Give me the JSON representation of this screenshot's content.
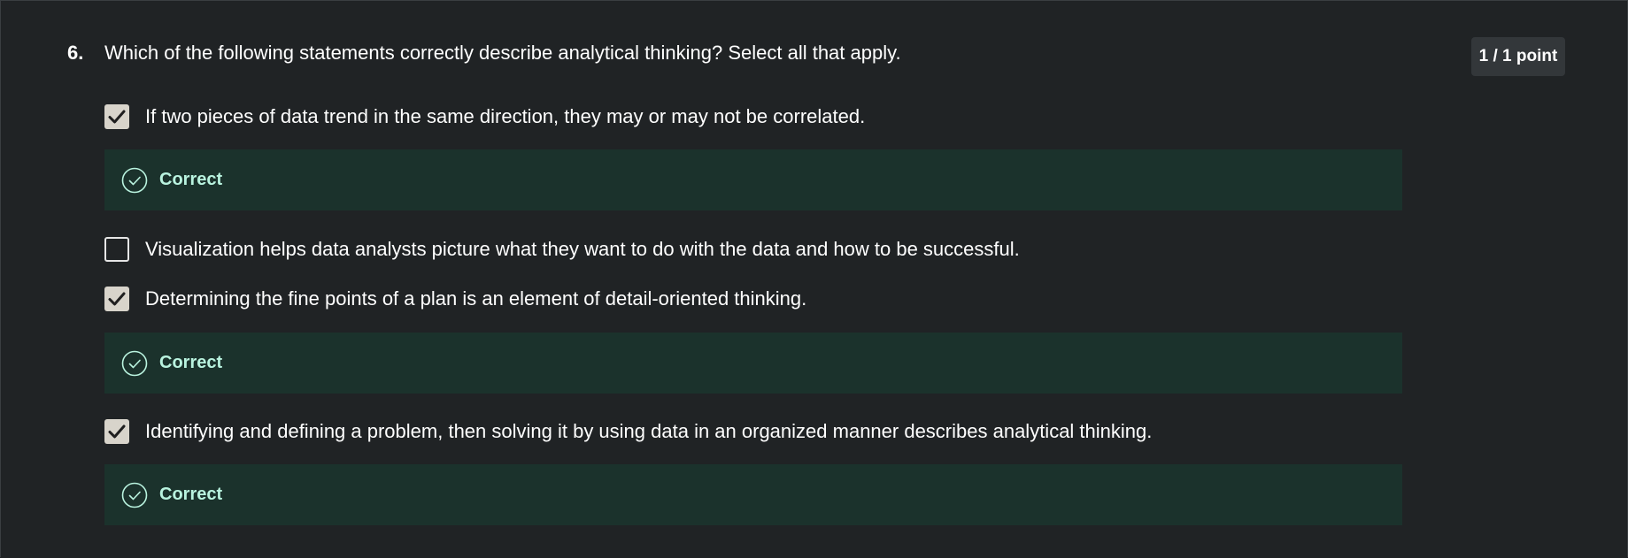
{
  "question": {
    "number": "6.",
    "text": "Which of the following statements correctly describe analytical thinking? Select all that apply.",
    "score": "1 / 1 point"
  },
  "options": [
    {
      "label": "If two pieces of data trend in the same direction, they may or may not be correlated.",
      "checked": true,
      "feedback": "Correct"
    },
    {
      "label": "Visualization helps data analysts picture what they want to do with the data and how to be successful.",
      "checked": false
    },
    {
      "label": "Determining the fine points of a plan is an element of detail-oriented thinking.",
      "checked": true,
      "feedback": "Correct"
    },
    {
      "label": "Identifying and defining a problem, then solving it by using data in an organized manner describes analytical thinking.",
      "checked": true,
      "feedback": "Correct"
    }
  ],
  "colors": {
    "background": "#202325",
    "checkbox_checked": "#d8d4cb",
    "feedback_background": "#1b322c",
    "feedback_text": "#b9f3df"
  },
  "icons": {
    "check": "checkmark-icon",
    "correct": "check-circle-icon"
  }
}
